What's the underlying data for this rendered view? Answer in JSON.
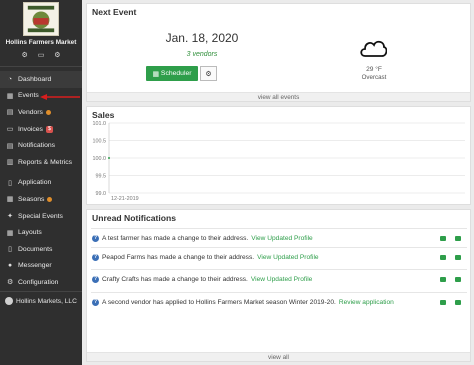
{
  "sidebar": {
    "org_name": "Hollins Farmers Market",
    "org_icons": [
      "settings-icon",
      "id-card-icon",
      "share-icon"
    ],
    "items": [
      {
        "label": "Dashboard",
        "icon": "dashboard-icon",
        "active": true
      },
      {
        "label": "Events",
        "icon": "calendar-icon"
      },
      {
        "label": "Vendors",
        "icon": "vendors-icon",
        "dot": true
      },
      {
        "label": "Invoices",
        "icon": "invoice-icon",
        "badge": "$"
      },
      {
        "label": "Notifications",
        "icon": "bell-icon"
      },
      {
        "label": "Reports & Metrics",
        "icon": "chart-icon"
      },
      {
        "label": "Application",
        "icon": "document-icon"
      },
      {
        "label": "Seasons",
        "icon": "season-icon",
        "dot": true
      },
      {
        "label": "Special Events",
        "icon": "star-icon"
      },
      {
        "label": "Layouts",
        "icon": "layout-icon"
      },
      {
        "label": "Documents",
        "icon": "folder-icon"
      },
      {
        "label": "Messenger",
        "icon": "chat-icon"
      },
      {
        "label": "Configuration",
        "icon": "gear-icon"
      }
    ],
    "account": "Hollins Markets, LLC"
  },
  "next_event": {
    "title": "Next Event",
    "date": "Jan. 18, 2020",
    "vendors": "3 vendors",
    "scheduler_label": "Scheduler",
    "weather": {
      "icon": "cloud-icon",
      "temp": "29 °F",
      "condition": "Overcast"
    },
    "view_all": "view all events"
  },
  "sales": {
    "title": "Sales",
    "chart_data": {
      "type": "line",
      "x": [
        "12-21-2019"
      ],
      "series": [
        {
          "values": [
            100
          ]
        }
      ],
      "ylim": [
        99.0,
        101.0
      ],
      "yticks": [
        "101.0",
        "100.5",
        "100.0",
        "99.5",
        "99.0"
      ],
      "grid": true
    }
  },
  "notifications": {
    "title": "Unread Notifications",
    "items": [
      {
        "text": "A test farmer has made a change to their address.",
        "link": "View Updated Profile"
      },
      {
        "text": "Peapod Farms has made a change to their address.",
        "link": "View Updated Profile"
      },
      {
        "text": "Crafty Crafts has made a change to their address.",
        "link": "View Updated Profile"
      },
      {
        "text": "A second vendor has applied to Hollins Farmers Market season Winter 2019-20.",
        "link": "Review application"
      }
    ],
    "view_all": "view all"
  },
  "colors": {
    "accent": "#2e9e4a",
    "sidebar": "#2f2f2f",
    "annotation": "#d81e1e"
  }
}
